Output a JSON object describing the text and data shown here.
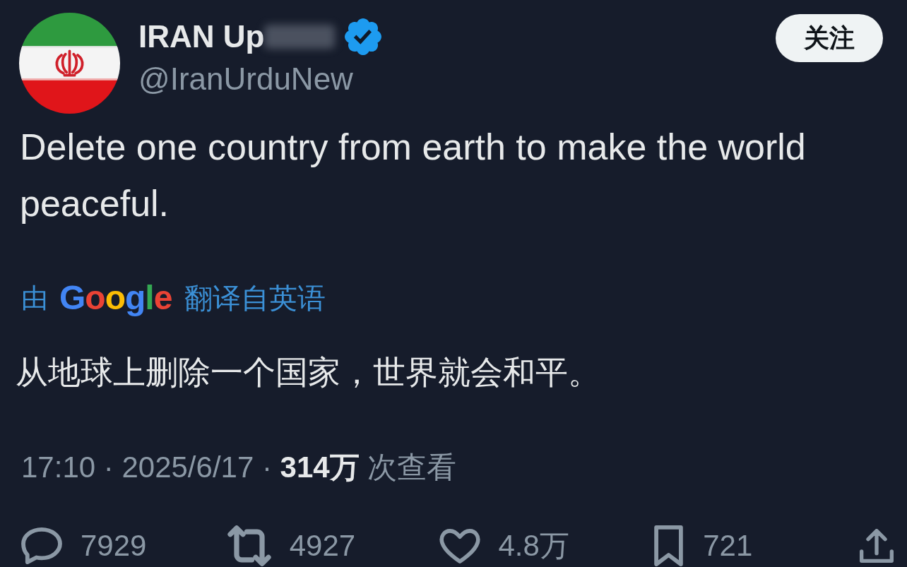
{
  "author": {
    "name": "IRAN Up",
    "name_blurred": true,
    "verified": true,
    "handle": "@IranUrduNew"
  },
  "follow_button": {
    "label": "关注"
  },
  "tweet": {
    "text": "Delete one country from earth to make the world peaceful."
  },
  "translation": {
    "prefix": "由",
    "provider": "Google",
    "suffix": "翻译自英语",
    "text": "从地球上删除一个国家，世界就会和平。"
  },
  "meta": {
    "text": "17:10 · 2025/6/17 · **314万** 次查看"
  },
  "actions": [
    {
      "kind": "reply",
      "count": "7929"
    },
    {
      "kind": "retweet",
      "count": "4927"
    },
    {
      "kind": "like",
      "count": "4.8万"
    },
    {
      "kind": "bookmark",
      "count": "721"
    },
    {
      "kind": "share"
    }
  ]
}
